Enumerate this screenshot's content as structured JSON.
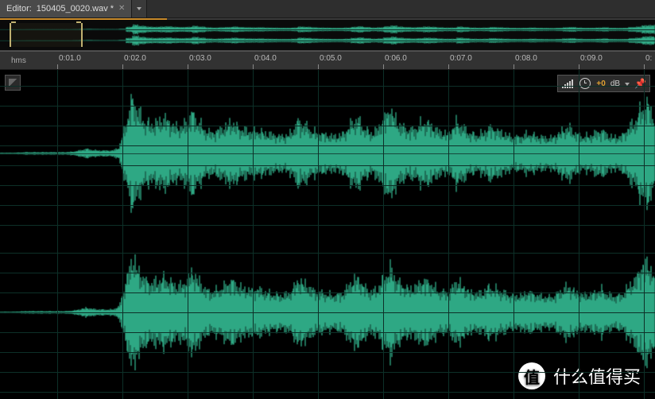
{
  "tab": {
    "prefix": "Editor:",
    "filename": "150405_0020.wav *"
  },
  "timeline": {
    "unit": "hms",
    "ticks": [
      "0:01.0",
      "0:02.0",
      "0:03.0",
      "0:04.0",
      "0:05.0",
      "0:06.0",
      "0:07.0",
      "0:08.0",
      "0:09.0",
      "0:"
    ],
    "start": 0.0,
    "end": 10.0
  },
  "hud": {
    "db_value": "+0",
    "db_unit": "dB"
  },
  "watermark": {
    "badge": "值",
    "text": "什么值得买"
  },
  "chart_data": {
    "type": "waveform",
    "title": "Stereo audio waveform, two channels",
    "x_unit": "seconds",
    "x_range": [
      0,
      10
    ],
    "y_unit": "normalized amplitude",
    "y_range": [
      -1,
      1
    ],
    "channels": 2,
    "envelope_dt": 0.1,
    "envelope": [
      0.01,
      0.01,
      0.01,
      0.015,
      0.02,
      0.02,
      0.02,
      0.02,
      0.02,
      0.02,
      0.02,
      0.03,
      0.05,
      0.08,
      0.06,
      0.05,
      0.05,
      0.05,
      0.1,
      0.5,
      0.95,
      0.7,
      0.55,
      0.5,
      0.55,
      0.6,
      0.5,
      0.45,
      0.5,
      0.7,
      0.55,
      0.4,
      0.35,
      0.4,
      0.45,
      0.55,
      0.45,
      0.4,
      0.38,
      0.4,
      0.35,
      0.33,
      0.3,
      0.3,
      0.35,
      0.55,
      0.5,
      0.4,
      0.35,
      0.33,
      0.3,
      0.3,
      0.35,
      0.5,
      0.6,
      0.45,
      0.35,
      0.4,
      0.6,
      0.75,
      0.55,
      0.45,
      0.4,
      0.45,
      0.55,
      0.5,
      0.4,
      0.35,
      0.35,
      0.55,
      0.45,
      0.35,
      0.32,
      0.35,
      0.45,
      0.4,
      0.35,
      0.3,
      0.28,
      0.3,
      0.35,
      0.3,
      0.28,
      0.26,
      0.3,
      0.4,
      0.45,
      0.35,
      0.3,
      0.3,
      0.35,
      0.4,
      0.3,
      0.28,
      0.3,
      0.45,
      0.55,
      0.8,
      0.85,
      0.6
    ]
  }
}
